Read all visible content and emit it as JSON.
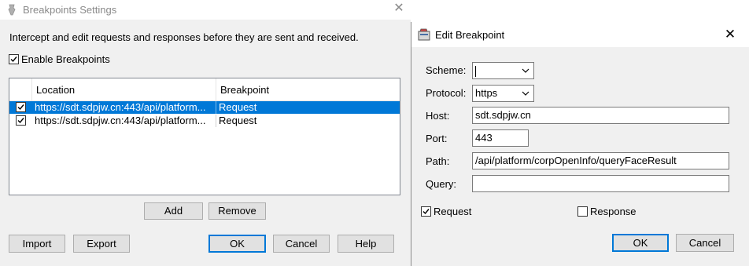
{
  "settings": {
    "title": "Breakpoints Settings",
    "description": "Intercept and edit requests and responses before they are sent and received.",
    "enable_label": "Enable Breakpoints",
    "enable_checked": true,
    "table": {
      "columns": [
        "Location",
        "Breakpoint"
      ],
      "rows": [
        {
          "checked": true,
          "location": "https://sdt.sdpjw.cn:443/api/platform...",
          "breakpoint": "Request",
          "selected": true
        },
        {
          "checked": true,
          "location": "https://sdt.sdpjw.cn:443/api/platform...",
          "breakpoint": "Request",
          "selected": false
        }
      ]
    },
    "add_label": "Add",
    "remove_label": "Remove",
    "import_label": "Import",
    "export_label": "Export",
    "ok_label": "OK",
    "cancel_label": "Cancel",
    "help_label": "Help"
  },
  "edit": {
    "title": "Edit Breakpoint",
    "scheme_label": "Scheme:",
    "scheme_value": "",
    "protocol_label": "Protocol:",
    "protocol_value": "https",
    "host_label": "Host:",
    "host_value": "sdt.sdpjw.cn",
    "port_label": "Port:",
    "port_value": "443",
    "path_label": "Path:",
    "path_value": "/api/platform/corpOpenInfo/queryFaceResult",
    "query_label": "Query:",
    "query_value": "",
    "request_label": "Request",
    "request_checked": true,
    "response_label": "Response",
    "response_checked": false,
    "ok_label": "OK",
    "cancel_label": "Cancel"
  },
  "colors": {
    "selection": "#0078d7",
    "dialog_bg": "#f0f0f0",
    "button_bg": "#e1e1e1"
  },
  "icons": [
    "app-icon",
    "close-icon",
    "checkbox-checked-icon",
    "chevron-down-icon"
  ]
}
